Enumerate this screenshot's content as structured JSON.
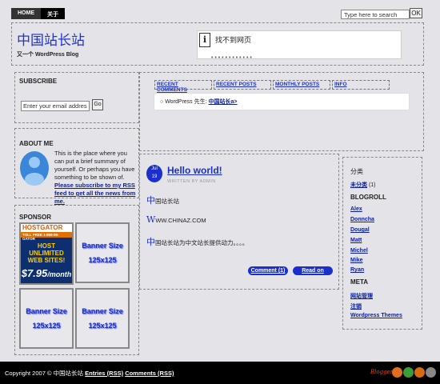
{
  "nav": {
    "items": [
      "HOME",
      "关于"
    ]
  },
  "search": {
    "placeholder": "Type here to search",
    "value": "Type here to search",
    "button": "OK"
  },
  "header": {
    "title": "中国站长站",
    "description": "又一个 WordPress Blog"
  },
  "notice": {
    "text": "找不到网页",
    "fragment": "• • •   • • •   •   • • •   • •"
  },
  "subscribe": {
    "heading": "SUBSCRIBE",
    "email_value": "Enter your email address...",
    "button": "Go"
  },
  "about": {
    "heading": "ABOUT ME",
    "text": "This is the place where you can put a brief summary of yourself. Or perhaps you have something to be shown of.",
    "link": "Please subscribe to my RSS feed to get all the news from me."
  },
  "sponsor": {
    "heading": "SPONSOR",
    "hostgator": {
      "name": "HOSTGATOR",
      "tagline": "TOLL FREE 1-866-96-GATOR",
      "line1": "HOST UNLIMITED",
      "line2": "WEB SITES!",
      "price": "$7.95",
      "period": "/month"
    },
    "banners": [
      {
        "line1": "Banner Size",
        "line2": "125x125"
      },
      {
        "line1": "Banner Size",
        "line2": "125x125"
      },
      {
        "line1": "Banner Size",
        "line2": "125x125"
      }
    ]
  },
  "tabs": {
    "items": [
      "RECENT COMMENTS",
      "RECENT POSTS",
      "MONTHLY POSTS",
      "INFO"
    ],
    "recent": {
      "author": "WordPress 先生:",
      "link": "中国站长a>"
    }
  },
  "post": {
    "date_month": "Jul",
    "date_day": "19",
    "title": "Hello world!",
    "meta": "WRITTEN BY ADMIN",
    "p1_big": "中",
    "p1": "国站长站",
    "p2_big": "W",
    "p2": "WW.CHINAZ.COM",
    "p3_big": "中",
    "p3": "国站长站为中文站长提供动力。。。。",
    "comment_btn": "Comment (1)",
    "read_btn": "Read on"
  },
  "rightbar": {
    "categories_heading": "分类",
    "category": "未分类",
    "category_count": "(1)",
    "blogroll_heading": "BLOGROLL",
    "blogroll": [
      "Alex",
      "Donncha",
      "Dougal",
      "Matt",
      "Michel",
      "Mike",
      "Ryan"
    ],
    "meta_heading": "META",
    "meta": [
      "网站管理",
      "注销",
      "Wordpress Themes"
    ]
  },
  "footer": {
    "copyright": "Copyright 2007 © 中国站长站",
    "entries": "Entries (RSS)",
    "comments": "Comments (RSS)",
    "brand": "Bloggerz"
  },
  "colors": {
    "accent": "#1a2fcc",
    "background": "#e4e4e8",
    "footer": "#000000"
  }
}
